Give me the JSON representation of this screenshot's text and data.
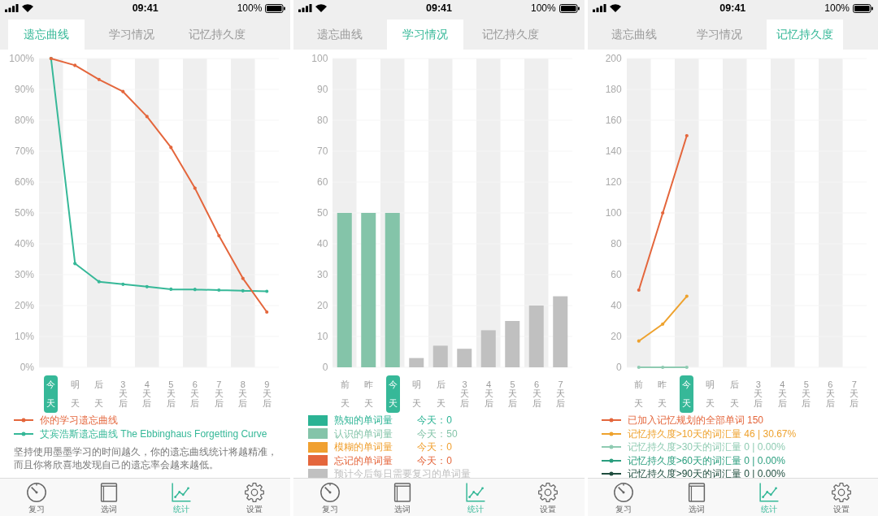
{
  "screens": [
    {
      "status_bar": {
        "time": "09:41",
        "battery": "100%"
      },
      "tabs": [
        {
          "label": "遗忘曲线",
          "selected": true
        },
        {
          "label": "学习情况",
          "selected": false
        },
        {
          "label": "记忆持久度",
          "selected": false
        }
      ],
      "chart": {
        "chart_data": {
          "type": "line",
          "categories": [
            "今天",
            "明天",
            "后天",
            "3天后",
            "4天后",
            "5天后",
            "6天后",
            "7天后",
            "8天后",
            "9天后"
          ],
          "ylim": [
            0,
            100
          ],
          "yticks": [
            {
              "value": 0,
              "label": "0%"
            },
            {
              "value": 10,
              "label": "10%"
            },
            {
              "value": 20,
              "label": "20%"
            },
            {
              "value": 30,
              "label": "30%"
            },
            {
              "value": 40,
              "label": "40%"
            },
            {
              "value": 50,
              "label": "50%"
            },
            {
              "value": 60,
              "label": "60%"
            },
            {
              "value": 70,
              "label": "70%"
            },
            {
              "value": 80,
              "label": "80%"
            },
            {
              "value": 90,
              "label": "90%"
            },
            {
              "value": 100,
              "label": "100%"
            }
          ],
          "series": [
            {
              "name": "你的学习遗忘曲线",
              "color": "#e4663c",
              "marker": "circle",
              "values": [
                100,
                97.8,
                93.2,
                89.3,
                81.2,
                71.2,
                58.0,
                42.6,
                28.8,
                17.9
              ]
            },
            {
              "name": "艾宾浩斯遗忘曲线 The Ebbinghaus Forgetting Curve",
              "color": "#36b898",
              "marker": "circle",
              "values": [
                100,
                33.6,
                27.7,
                26.9,
                26.1,
                25.3,
                25.2,
                25.0,
                24.8,
                24.6
              ]
            }
          ]
        },
        "x_axis": [
          {
            "selected": true
          },
          {
            "selected": false
          },
          {
            "selected": false
          },
          {
            "selected": false
          },
          {
            "selected": false
          },
          {
            "selected": false
          },
          {
            "selected": false
          },
          {
            "selected": false
          },
          {
            "selected": false
          },
          {
            "selected": false
          }
        ]
      },
      "description": "坚持使用墨墨学习的时间越久，你的遗忘曲线统计将越精准，而且你将欣喜地发现自己的遗忘率会越来越低。",
      "bottom_nav": [
        {
          "label": "复习",
          "selected": false
        },
        {
          "label": "选词",
          "selected": false
        },
        {
          "label": "统计",
          "selected": true
        },
        {
          "label": "设置",
          "selected": false
        }
      ]
    },
    {
      "status_bar": {
        "time": "09:41",
        "battery": "100%"
      },
      "tabs": [
        {
          "label": "遗忘曲线",
          "selected": false
        },
        {
          "label": "学习情况",
          "selected": true
        },
        {
          "label": "记忆持久度",
          "selected": false
        }
      ],
      "chart": {
        "chart_data": {
          "type": "bar",
          "categories": [
            "前天",
            "昨天",
            "今天",
            "明天",
            "后天",
            "3天后",
            "4天后",
            "5天后",
            "6天后",
            "7天后"
          ],
          "ylim": [
            0,
            100
          ],
          "yticks": [
            {
              "value": 0,
              "label": "0"
            },
            {
              "value": 10,
              "label": "10"
            },
            {
              "value": 20,
              "label": "20"
            },
            {
              "value": 30,
              "label": "30"
            },
            {
              "value": 40,
              "label": "40"
            },
            {
              "value": 50,
              "label": "50"
            },
            {
              "value": 60,
              "label": "60"
            },
            {
              "value": 70,
              "label": "70"
            },
            {
              "value": 80,
              "label": "80"
            },
            {
              "value": 90,
              "label": "90"
            },
            {
              "value": 100,
              "label": "100"
            }
          ],
          "series": [
            {
              "name": "熟知的单词量",
              "color": "#2bb394",
              "values": [
                0,
                0,
                0,
                0,
                0,
                0,
                0,
                0,
                0,
                0
              ]
            },
            {
              "name": "认识的单词量",
              "color": "#84c4a9",
              "values": [
                50,
                50,
                50,
                0,
                0,
                0,
                0,
                0,
                0,
                0
              ]
            },
            {
              "name": "模糊的单词量",
              "color": "#f0a030",
              "values": [
                0,
                0,
                0,
                0,
                0,
                0,
                0,
                0,
                0,
                0
              ]
            },
            {
              "name": "忘记的单词量",
              "color": "#e4663c",
              "values": [
                0,
                0,
                0,
                0,
                0,
                0,
                0,
                0,
                0,
                0
              ]
            },
            {
              "name": "预计今后每日需要复习的单词量",
              "color": "#c0c0c0",
              "values": [
                0,
                0,
                0,
                3,
                7,
                6,
                12,
                15,
                20,
                23
              ]
            }
          ]
        },
        "x_axis": [
          {
            "selected": false
          },
          {
            "selected": false
          },
          {
            "selected": true
          },
          {
            "selected": false
          },
          {
            "selected": false
          },
          {
            "selected": false
          },
          {
            "selected": false
          },
          {
            "selected": false
          },
          {
            "selected": false
          },
          {
            "selected": false
          }
        ],
        "legend_today": [
          "今天：0",
          "今天：50",
          "今天：0",
          "今天：0"
        ]
      },
      "bottom_nav": [
        {
          "label": "复习",
          "selected": false
        },
        {
          "label": "选词",
          "selected": false
        },
        {
          "label": "统计",
          "selected": true
        },
        {
          "label": "设置",
          "selected": false
        }
      ]
    },
    {
      "status_bar": {
        "time": "09:41",
        "battery": "100%"
      },
      "tabs": [
        {
          "label": "遗忘曲线",
          "selected": false
        },
        {
          "label": "学习情况",
          "selected": false
        },
        {
          "label": "记忆持久度",
          "selected": true
        }
      ],
      "chart": {
        "chart_data": {
          "type": "line",
          "categories": [
            "前天",
            "昨天",
            "今天",
            "明天",
            "后天",
            "3天后",
            "4天后",
            "5天后",
            "6天后",
            "7天后"
          ],
          "ylim": [
            0,
            200
          ],
          "yticks": [
            {
              "value": 0,
              "label": "0"
            },
            {
              "value": 20,
              "label": "20"
            },
            {
              "value": 40,
              "label": "40"
            },
            {
              "value": 60,
              "label": "60"
            },
            {
              "value": 80,
              "label": "80"
            },
            {
              "value": 100,
              "label": "100"
            },
            {
              "value": 120,
              "label": "120"
            },
            {
              "value": 140,
              "label": "140"
            },
            {
              "value": 160,
              "label": "160"
            },
            {
              "value": 180,
              "label": "180"
            },
            {
              "value": 200,
              "label": "200"
            }
          ],
          "series": [
            {
              "name": "已加入记忆规划的全部单词 150",
              "color": "#e4663c",
              "marker": "circle",
              "values": [
                50,
                100,
                150,
                null,
                null,
                null,
                null,
                null,
                null,
                null
              ]
            },
            {
              "name": "记忆持久度>10天的词汇量 46 | 30.67%",
              "color": "#eea22e",
              "marker": "circle",
              "values": [
                17,
                28,
                46,
                null,
                null,
                null,
                null,
                null,
                null,
                null
              ]
            },
            {
              "name": "记忆持久度>30天的词汇量 0 | 0.00%",
              "color": "#8fcbb2",
              "marker": "circle",
              "values": [
                0,
                0,
                0,
                null,
                null,
                null,
                null,
                null,
                null,
                null
              ]
            },
            {
              "name": "记忆持久度>60天的词汇量 0 | 0.00%",
              "color": "#2a9e7e",
              "marker": "circle",
              "values": [
                null,
                null,
                null,
                null,
                null,
                null,
                null,
                null,
                null,
                null
              ]
            },
            {
              "name": "记忆持久度>90天的词汇量 0 | 0.00%",
              "color": "#1f4d3e",
              "marker": "circle",
              "values": [
                null,
                null,
                null,
                null,
                null,
                null,
                null,
                null,
                null,
                null
              ]
            }
          ]
        },
        "x_axis": [
          {
            "selected": false
          },
          {
            "selected": false
          },
          {
            "selected": true
          },
          {
            "selected": false
          },
          {
            "selected": false
          },
          {
            "selected": false
          },
          {
            "selected": false
          },
          {
            "selected": false
          },
          {
            "selected": false
          },
          {
            "selected": false
          }
        ]
      },
      "bottom_nav": [
        {
          "label": "复习",
          "selected": false
        },
        {
          "label": "选词",
          "selected": false
        },
        {
          "label": "统计",
          "selected": true
        },
        {
          "label": "设置",
          "selected": false
        }
      ]
    }
  ]
}
